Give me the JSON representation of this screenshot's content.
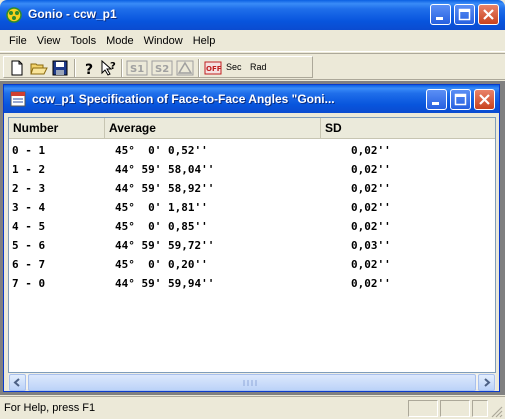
{
  "window": {
    "title": "Gonio - ccw_p1"
  },
  "menu": {
    "items": [
      "File",
      "View",
      "Tools",
      "Mode",
      "Window",
      "Help"
    ]
  },
  "toolbar": {
    "sec_label": "Sec",
    "rad_label": "Rad"
  },
  "child_window": {
    "title": "ccw_p1 Specification of Face-to-Face Angles  \"Goni..."
  },
  "table": {
    "headers": [
      "Number",
      "Average",
      "SD"
    ],
    "rows": [
      {
        "number": "0 - 1",
        "average": "45°  0' 0,52''",
        "sd": "0,02''"
      },
      {
        "number": "1 - 2",
        "average": "44° 59' 58,04''",
        "sd": "0,02''"
      },
      {
        "number": "2 - 3",
        "average": "44° 59' 58,92''",
        "sd": "0,02''"
      },
      {
        "number": "3 - 4",
        "average": "45°  0' 1,81''",
        "sd": "0,02''"
      },
      {
        "number": "4 - 5",
        "average": "45°  0' 0,85''",
        "sd": "0,02''"
      },
      {
        "number": "5 - 6",
        "average": "44° 59' 59,72''",
        "sd": "0,03''"
      },
      {
        "number": "6 - 7",
        "average": "45°  0' 0,20''",
        "sd": "0,02''"
      },
      {
        "number": "7 - 0",
        "average": "44° 59' 59,94''",
        "sd": "0,02''"
      }
    ]
  },
  "statusbar": {
    "text": "For Help, press F1"
  },
  "colors": {
    "titlebar": "#0855DD",
    "close_button": "#C8421E",
    "face": "#ECE9D8"
  }
}
